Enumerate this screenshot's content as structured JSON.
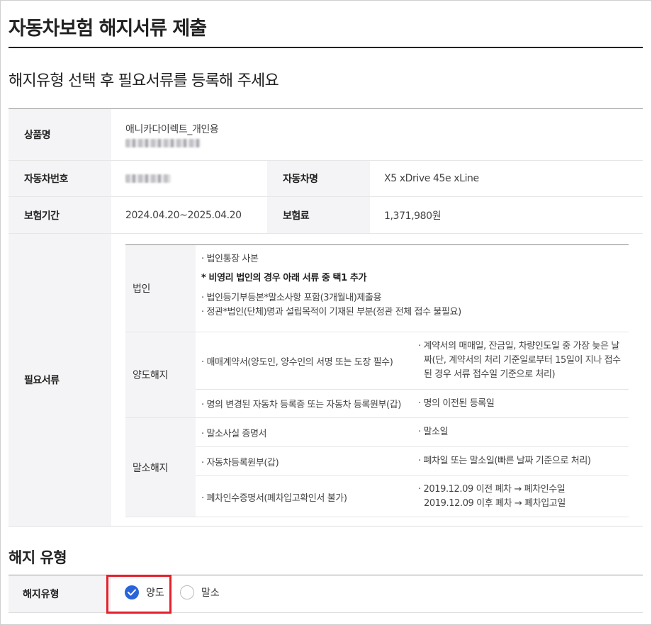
{
  "header": {
    "title": "자동차보험 해지서류 제출",
    "subtitle": "해지유형 선택 후 필요서류를 등록해 주세요"
  },
  "info": {
    "product_label": "상품명",
    "product_name": "애니카다이렉트_개인용",
    "car_number_label": "자동차번호",
    "car_name_label": "자동차명",
    "car_name": "X5 xDrive 45e xLine",
    "period_label": "보험기간",
    "period": "2024.04.20~2025.04.20",
    "premium_label": "보험료",
    "premium": "1,371,980원",
    "docs_label": "필요서류"
  },
  "docs": {
    "corporate": {
      "name": "법인",
      "line1": "· 법인통장 사본",
      "note": "* 비영리 법인의 경우 아래 서류 중 택1 추가",
      "line2": "· 법인등기부등본*말소사항 포함(3개월내)제출용",
      "line3": "· 정관*법인(단체)명과 설립목적이 기재된 부분(정관 전체 접수 불필요)"
    },
    "transfer": {
      "name": "양도해지",
      "rows": [
        {
          "doc": "· 매매계약서(양도인, 양수인의 서명 또는 도장 필수)",
          "date_lines": [
            "· 계약서의 매매일, 잔금일, 차량인도일 중 가장 늦은 날",
            "짜(단, 계약서의 처리 기준일로부터 15일이 지나 접수",
            "된 경우 서류 접수일 기준으로 처리)"
          ]
        },
        {
          "doc": "· 명의 변경된 자동차 등록증 또는 자동차 등록원부(갑)",
          "date_lines": [
            "· 명의 이전된 등록일"
          ]
        }
      ]
    },
    "scrap": {
      "name": "말소해지",
      "rows": [
        {
          "doc": "· 말소사실 증명서",
          "date_lines": [
            "· 말소일"
          ]
        },
        {
          "doc": "· 자동차등록원부(갑)",
          "date_lines": [
            "· 폐차일 또는 말소일(빠른 날짜 기준으로 처리)"
          ]
        },
        {
          "doc": "· 폐차인수증명서(폐차입고확인서 불가)",
          "date_lines": [
            "· 2019.12.09 이전 폐차 → 폐차인수일",
            "2019.12.09 이후 폐차 → 폐차입고일"
          ]
        }
      ]
    }
  },
  "cancel_type": {
    "section_title": "해지 유형",
    "label": "해지유형",
    "options": [
      {
        "label": "양도",
        "selected": true
      },
      {
        "label": "말소",
        "selected": false
      }
    ],
    "accent_color": "#2a64d9",
    "highlight_color": "#e4202a"
  }
}
